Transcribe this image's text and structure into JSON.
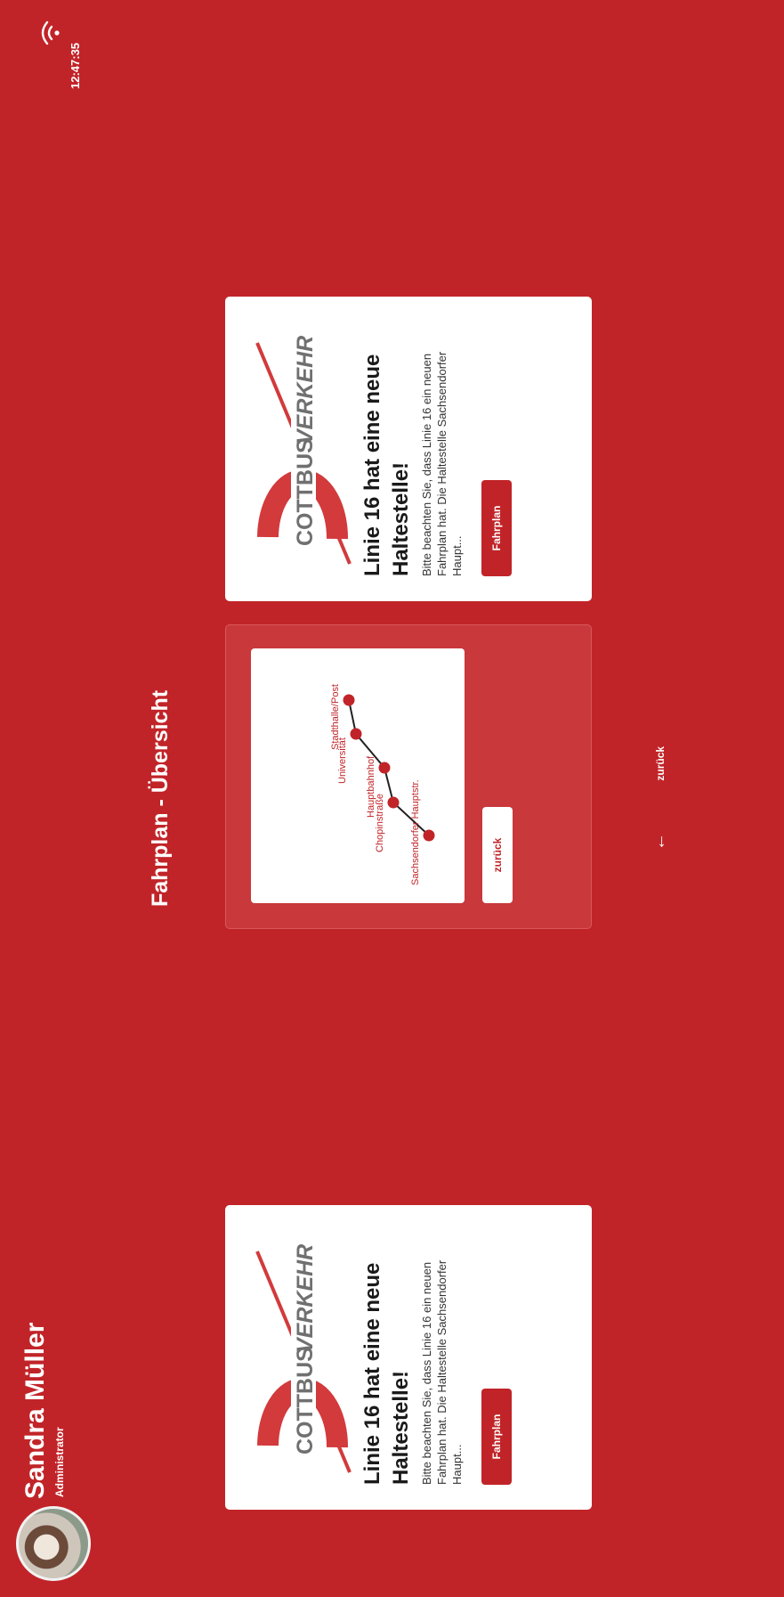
{
  "user": {
    "name": "Sandra Müller",
    "role": "Administrator"
  },
  "status": {
    "time": "12:47:35",
    "wifi_icon": "wifi-icon"
  },
  "page": {
    "title": "Fahrplan - Übersicht"
  },
  "cards": [
    {
      "logo_text_a": "COTTBUS",
      "logo_text_b": "VERKEHR",
      "title": "Linie 16 hat eine neue Haltestelle!",
      "text": "Bitte beachten Sie, dass Linie 16 ein neuen Fahrplan hat. Die Haltestelle Sachsendorfer Haupt...",
      "button": "Fahrplan"
    },
    {
      "logo_text_a": "COTTBUS",
      "logo_text_b": "VERKEHR",
      "title": "Linie 16 hat eine neue Haltestelle!",
      "text": "Bitte beachten Sie, dass Linie 16 ein neuen Fahrplan hat. Die Haltestelle Sachsendorfer Haupt...",
      "button": "Fahrplan"
    }
  ],
  "route": {
    "stops": [
      "Sachsendorfer Hauptstr.",
      "Chopinstraße",
      "Hauptbahnhof",
      "Universität",
      "Stadthalle/Post"
    ],
    "button": "zurück"
  },
  "nav": {
    "back_label": "zurück",
    "arrow_icon": "arrow-left-icon"
  },
  "colors": {
    "brand": "#c12428",
    "card": "#ffffff"
  }
}
